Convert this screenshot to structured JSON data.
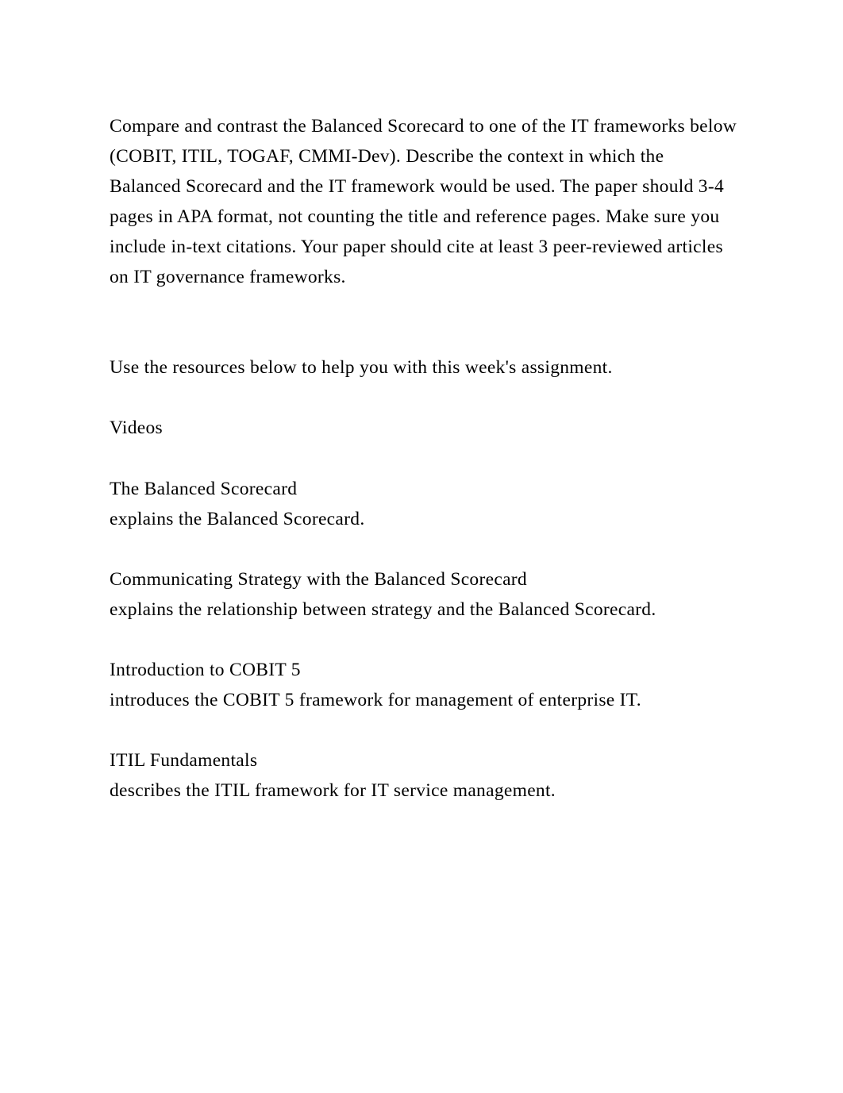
{
  "intro": "Compare and contrast the Balanced Scorecard to one of the IT frameworks below (COBIT, ITIL, TOGAF, CMMI-Dev). Describe the context in which the Balanced Scorecard and the IT framework would be used. The paper should 3-4 pages in APA format, not counting the title and reference pages. Make sure you include in-text citations. Your paper should cite at least 3 peer-reviewed articles on IT governance frameworks.",
  "assignment_note": "Use the resources below to help you with this week's assignment.",
  "videos_heading": "Videos",
  "resources": [
    {
      "title": "The Balanced Scorecard",
      "desc": " explains the Balanced Scorecard."
    },
    {
      "title": "Communicating Strategy with the Balanced Scorecard",
      "desc": " explains the relationship between strategy and the Balanced Scorecard."
    },
    {
      "title": "Introduction to COBIT 5",
      "desc": " introduces the COBIT 5 framework for management of enterprise IT."
    },
    {
      "title": "ITIL Fundamentals",
      "desc": " describes the ITIL framework for IT service management."
    }
  ]
}
